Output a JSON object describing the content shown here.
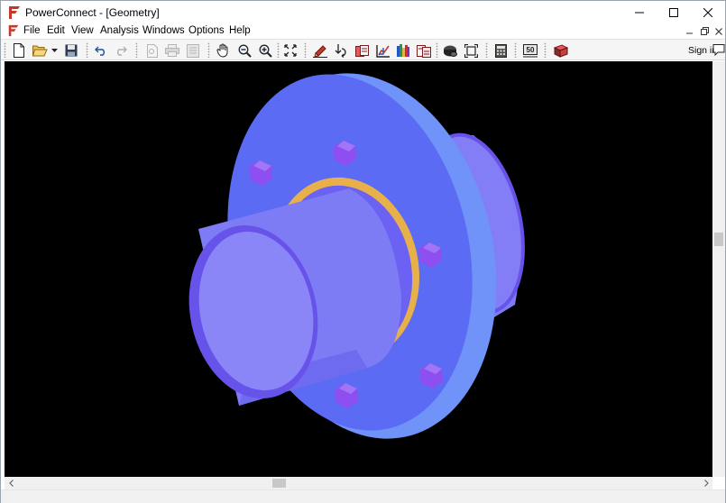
{
  "window": {
    "title": "PowerConnect - [Geometry]"
  },
  "menu": {
    "items": [
      "File",
      "Edit",
      "View",
      "Analysis",
      "Windows",
      "Options",
      "Help"
    ]
  },
  "toolbar": {
    "signin_label": "Sign in",
    "scale_badge": "50"
  },
  "model": {
    "colors": {
      "flange_face": "#5B6BF3",
      "flange_rim": "#6F93F8",
      "pipe": "#7E7CF4",
      "pipe_edge": "#6752EA",
      "gasket": "#E8B04A",
      "bolt": "#8D4FF0",
      "background": "#000000"
    },
    "bolt_count": 7
  }
}
